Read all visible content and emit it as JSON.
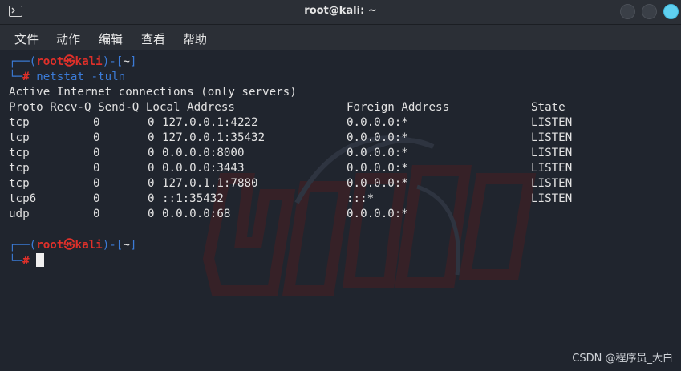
{
  "window": {
    "title": "root@kali: ~"
  },
  "menu": [
    "文件",
    "动作",
    "编辑",
    "查看",
    "帮助"
  ],
  "prompt": {
    "user": "root",
    "host": "kali",
    "dir": "~",
    "hash": "#",
    "symbol": "㉿"
  },
  "command": "netstat -tuln",
  "output_header": "Active Internet connections (only servers)",
  "columns": [
    "Proto",
    "Recv-Q",
    "Send-Q",
    "Local Address",
    "Foreign Address",
    "State"
  ],
  "rows": [
    [
      "tcp",
      "0",
      "0",
      "127.0.0.1:4222",
      "0.0.0.0:*",
      "LISTEN"
    ],
    [
      "tcp",
      "0",
      "0",
      "127.0.0.1:35432",
      "0.0.0.0:*",
      "LISTEN"
    ],
    [
      "tcp",
      "0",
      "0",
      "0.0.0.0:8000",
      "0.0.0.0:*",
      "LISTEN"
    ],
    [
      "tcp",
      "0",
      "0",
      "0.0.0.0:3443",
      "0.0.0.0:*",
      "LISTEN"
    ],
    [
      "tcp",
      "0",
      "0",
      "127.0.1.1:7880",
      "0.0.0.0:*",
      "LISTEN"
    ],
    [
      "tcp6",
      "0",
      "0",
      "::1:35432",
      ":::*",
      "LISTEN"
    ],
    [
      "udp",
      "0",
      "0",
      "0.0.0.0:68",
      "0.0.0.0:*",
      ""
    ]
  ],
  "watermark": "CSDN @程序员_大白",
  "colors": {
    "prompt_frame": "#3b7bd7",
    "prompt_user": "#e0302a",
    "background": "#20252e"
  }
}
